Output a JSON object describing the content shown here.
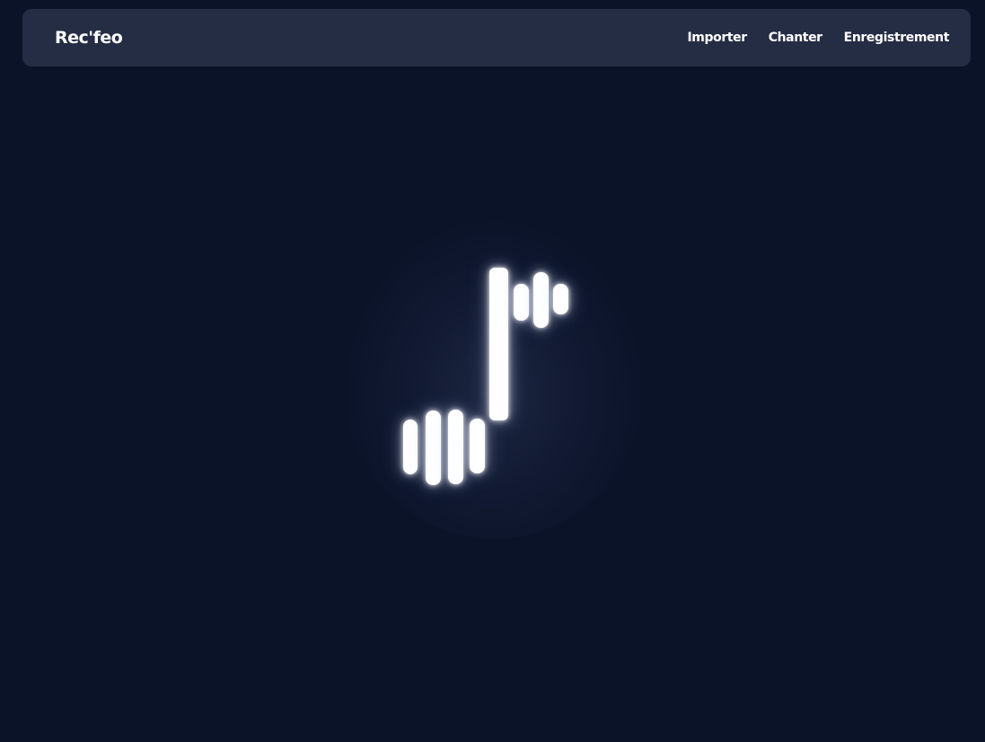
{
  "theme": {
    "background": "#0b1329",
    "navbar_background": "#252d45",
    "text": "#ffffff",
    "logo_color": "#ffffff"
  },
  "navbar": {
    "brand": "Rec'feo",
    "links": [
      "Importer",
      "Chanter",
      "Enregistrement"
    ]
  },
  "logo": {
    "icon": "music-note-waveform-icon"
  }
}
